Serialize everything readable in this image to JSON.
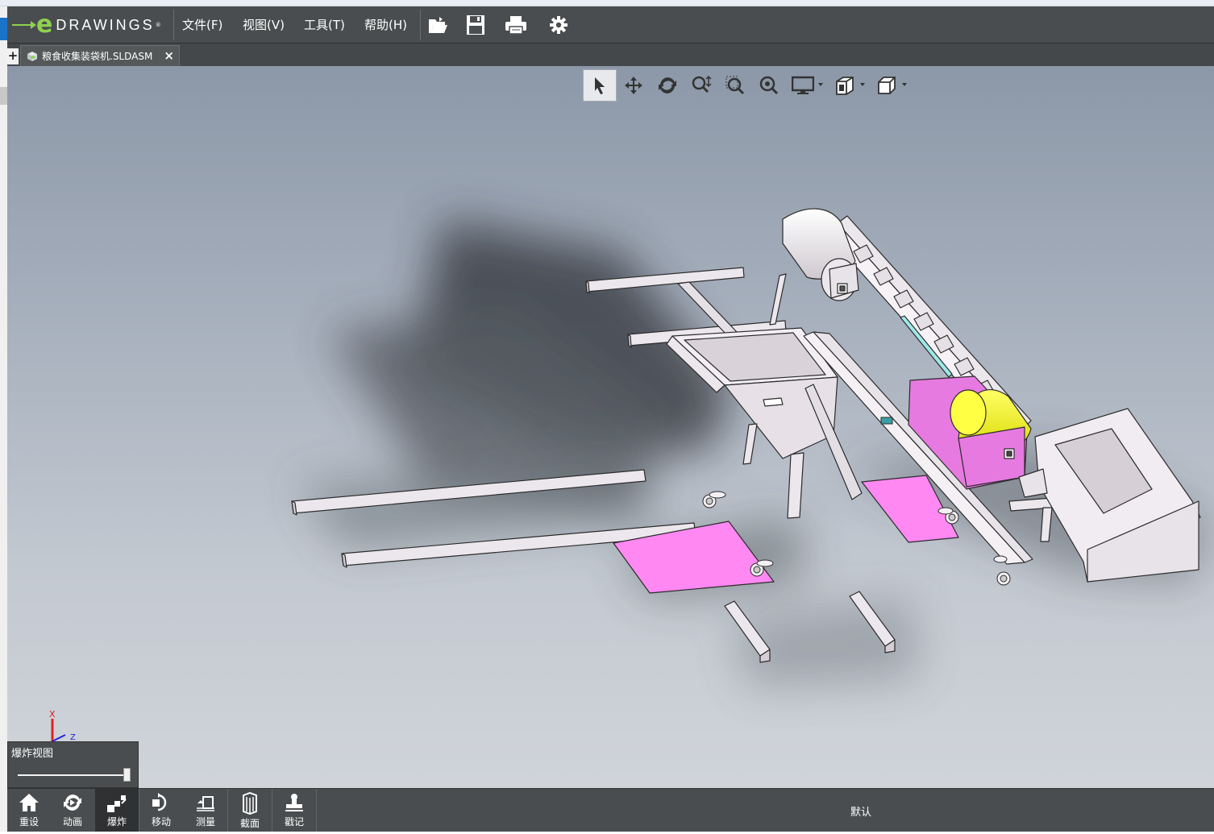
{
  "app": {
    "logo_word": "DRAWINGS",
    "logo_letter": "e",
    "logo_mark": "®"
  },
  "menu": {
    "items": [
      {
        "label": "文件(F)"
      },
      {
        "label": "视图(V)"
      },
      {
        "label": "工具(T)"
      },
      {
        "label": "帮助(H)"
      }
    ],
    "toolbar_icons": [
      "open-folder-icon",
      "save-icon",
      "print-icon",
      "settings-gear-icon"
    ]
  },
  "tabs": {
    "add_label": "+",
    "document": {
      "name": "粮食收集装袋机.SLDASM",
      "close_label": "×",
      "icon": "assembly-icon"
    }
  },
  "view_toolbar": {
    "icons": [
      "select-arrow-icon",
      "pan-icon",
      "rotate-icon",
      "zoom-icon",
      "zoom-to-area-icon",
      "zoom-to-fit-icon",
      "display-style-icon",
      "view-orientation-icon",
      "standard-views-icon"
    ]
  },
  "triad": {
    "x_label": "X",
    "z_label": "Z"
  },
  "explode_panel": {
    "title": "爆炸视图",
    "slider_value": 1.0
  },
  "bottom_toolbar": {
    "items": [
      {
        "label": "重设",
        "icon": "home-icon"
      },
      {
        "label": "动画",
        "icon": "animate-icon"
      },
      {
        "label": "爆炸",
        "icon": "explode-icon",
        "active": true
      },
      {
        "label": "移动",
        "icon": "move-icon"
      },
      {
        "label": "测量",
        "icon": "measure-icon"
      },
      {
        "label": "截面",
        "icon": "section-icon"
      },
      {
        "label": "戳记",
        "icon": "stamp-icon"
      }
    ],
    "status_text": "默认"
  },
  "colors": {
    "chrome": "#4a4d4f",
    "logo_green": "#8fd14f",
    "part_pink": "#ff88f2",
    "part_yellow": "#f5f52a",
    "part_white": "#ece7ec"
  }
}
